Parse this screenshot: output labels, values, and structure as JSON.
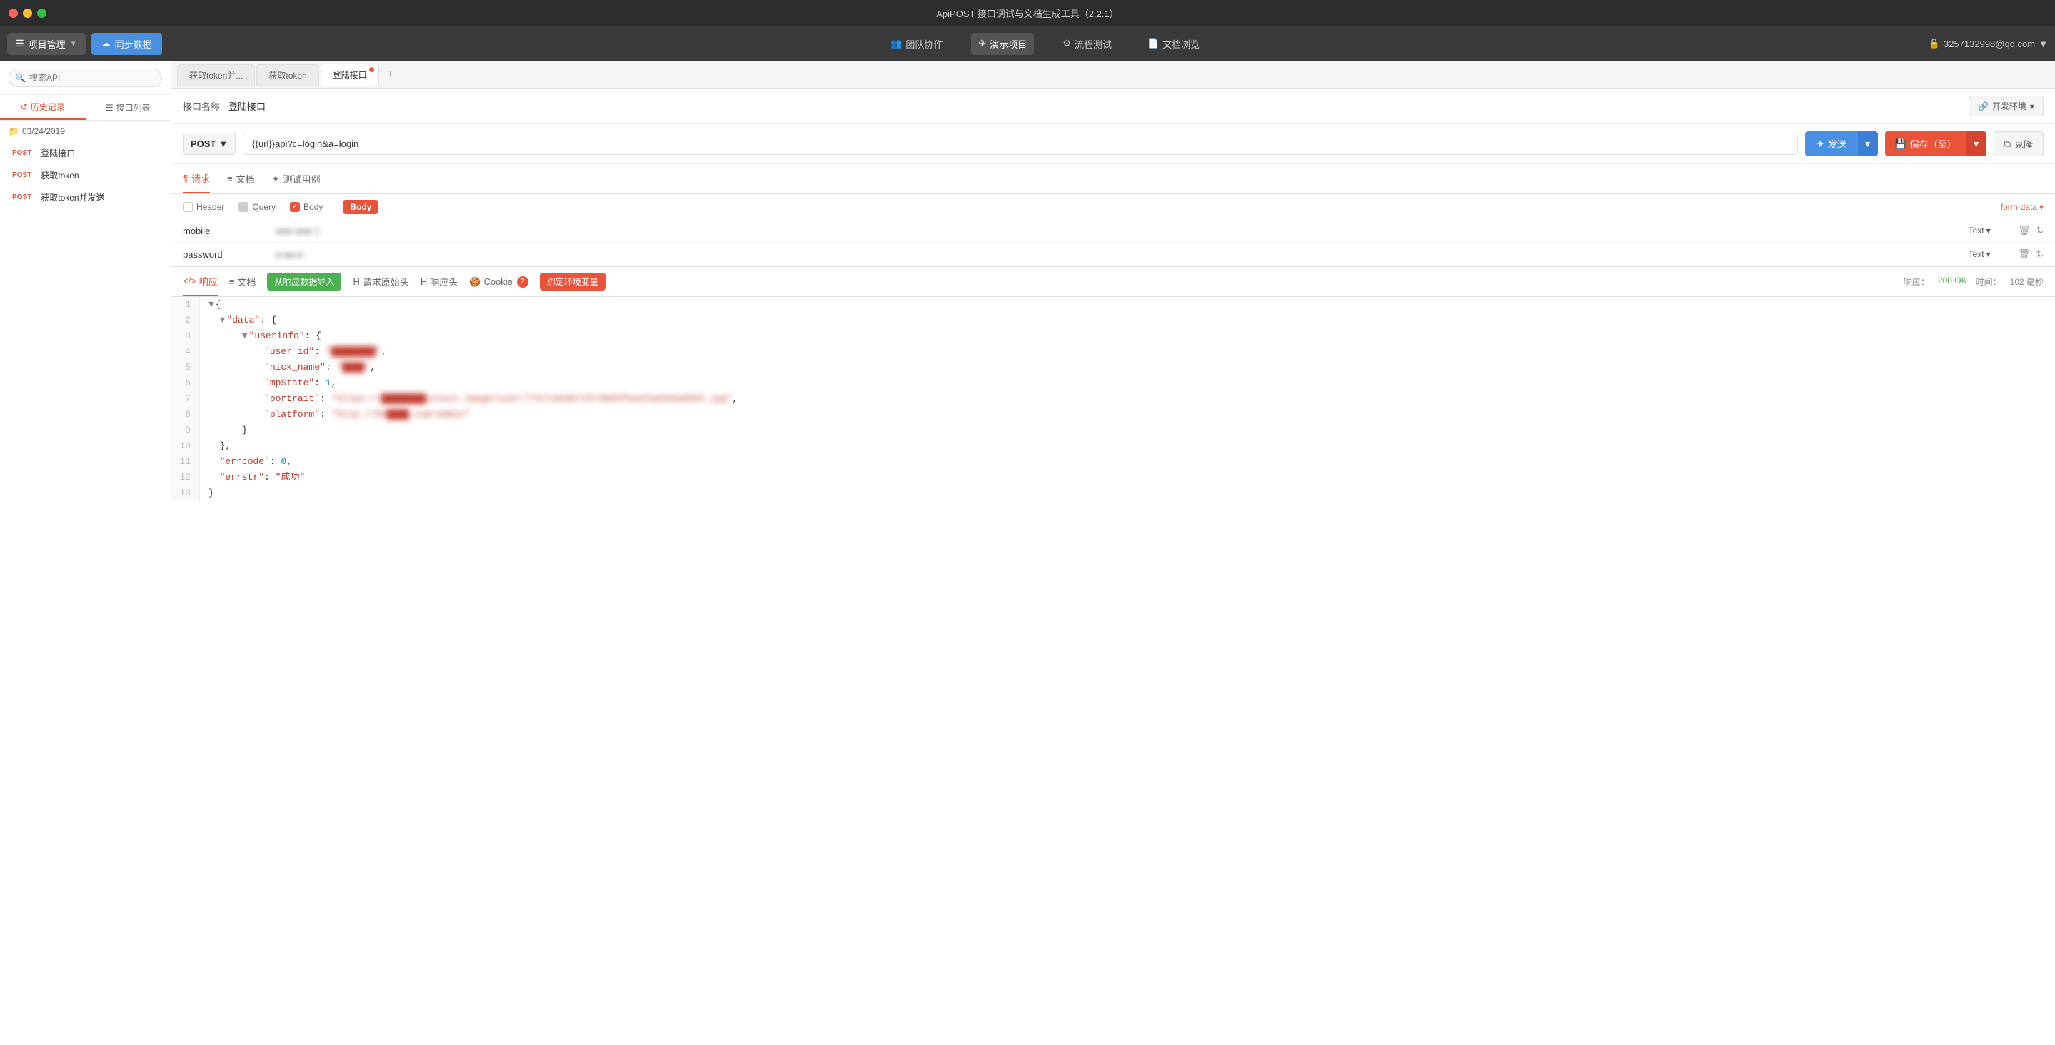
{
  "app": {
    "title": "ApiPOST 接口调试与文档生成工具（2.2.1）"
  },
  "titleBar": {
    "title": "ApiPOST 接口调试与文档生成工具（2.2.1）"
  },
  "topNav": {
    "projectManager": "项目管理",
    "syncData": "同步数据",
    "teamCollab": "团队协作",
    "demoProject": "演示项目",
    "flowTest": "流程测试",
    "docBrowse": "文档浏览",
    "userEmail": "3257132998@qq.com"
  },
  "sidebar": {
    "searchPlaceholder": "搜索API",
    "tab1": "历史记录",
    "tab2": "接口列表",
    "dateGroup": "03/24/2019",
    "items": [
      {
        "method": "POST",
        "name": "登陆接口"
      },
      {
        "method": "POST",
        "name": "获取token"
      },
      {
        "method": "POST",
        "name": "获取token并发送"
      }
    ]
  },
  "tabs": [
    {
      "label": "获取token并...",
      "active": false,
      "dot": false
    },
    {
      "label": "获取token",
      "active": false,
      "dot": false
    },
    {
      "label": "登陆接口",
      "active": true,
      "dot": true
    }
  ],
  "apiNameRow": {
    "label": "接口名称",
    "value": "登陆接口",
    "envBtn": "开发环境"
  },
  "urlBar": {
    "method": "POST",
    "url": "{{url}}api?c=login&a=login",
    "sendBtn": "发送",
    "saveBtn": "保存（至）",
    "cloneBtn": "克隆"
  },
  "requestTabs": [
    {
      "label": "请求",
      "icon": "¶",
      "active": true
    },
    {
      "label": "文档",
      "icon": "≡",
      "active": false
    },
    {
      "label": "测试用例",
      "icon": "✦",
      "active": false
    }
  ],
  "paramSection": {
    "header": "Header",
    "query": "Query",
    "body": "Body",
    "formData": "form-data"
  },
  "bodyFields": [
    {
      "name": "mobile",
      "value": "●●● ●●● 1",
      "type": "Text",
      "blurred": true
    },
    {
      "name": "password",
      "value": "●.●●.●",
      "type": "Text",
      "blurred": true
    }
  ],
  "responseTabs": [
    {
      "label": "响应",
      "icon": "</>",
      "active": true
    },
    {
      "label": "文档",
      "icon": "≡",
      "active": false
    }
  ],
  "responseActions": {
    "import": "从响应数据导入",
    "requestOriginal": "请求原始头",
    "responseHead": "响应头",
    "cookie": "Cookie",
    "cookieCount": "2",
    "bindEnv": "绑定环境变量"
  },
  "responseStatus": {
    "label": "响应：",
    "code": "200 OK",
    "timeLabel": "时间：",
    "time": "102 毫秒"
  },
  "codeLines": [
    {
      "num": "1",
      "content": "{",
      "collapse": "▼"
    },
    {
      "num": "2",
      "content": "  \"data\": {",
      "collapse": "▼"
    },
    {
      "num": "3",
      "content": "    \"userinfo\": {",
      "collapse": "▼"
    },
    {
      "num": "4",
      "content": "      \"user_id\": \"████\","
    },
    {
      "num": "5",
      "content": "      \"nick_name\": \"████\","
    },
    {
      "num": "6",
      "content": "      \"mpState\": 1,"
    },
    {
      "num": "7",
      "content": "      \"portrait\": \"https://████████xztest-image/user/77e7c843b723738d3fbee23a949a9563.jpg\","
    },
    {
      "num": "8",
      "content": "      \"platform\": \"http://99████.com/admin\""
    },
    {
      "num": "9",
      "content": "    }"
    },
    {
      "num": "10",
      "content": "  },"
    },
    {
      "num": "11",
      "content": "  \"errcode\": 0,"
    },
    {
      "num": "12",
      "content": "  \"errstr\": \"成功\""
    },
    {
      "num": "13",
      "content": "}"
    }
  ]
}
